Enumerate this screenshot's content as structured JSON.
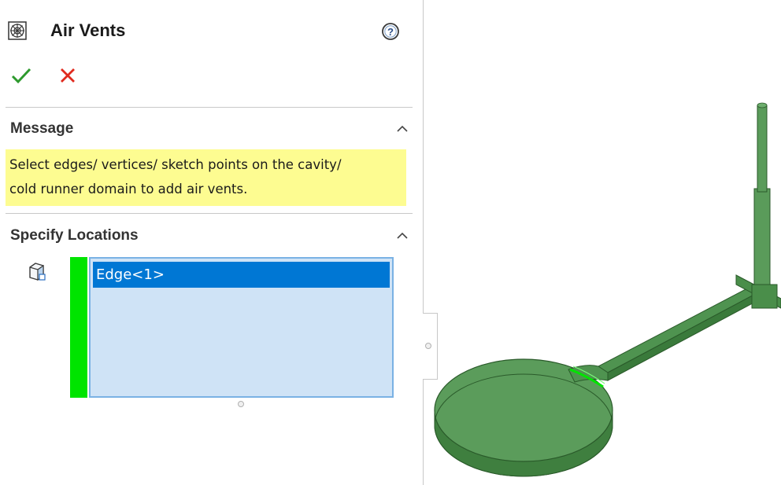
{
  "panel": {
    "title": "Air Vents",
    "icon": "air-vent-feature-icon",
    "help_icon": "help-icon",
    "ok_icon": "checkmark-icon",
    "cancel_icon": "close-icon",
    "ok_color": "#2e9a2e",
    "cancel_color": "#e02a1e"
  },
  "message_section": {
    "title": "Message",
    "collapse_icon": "chevron-up-icon",
    "lines": [
      "Select edges/ vertices/ sketch points on the cavity/",
      "cold runner domain to add air vents."
    ],
    "background": "#fdfc91"
  },
  "locations_section": {
    "title": "Specify Locations",
    "collapse_icon": "chevron-up-icon",
    "selection_icon": "edge-selection-icon",
    "status_color": "#00e400",
    "items": [
      {
        "label": "Edge<1>",
        "selected": true
      }
    ],
    "selected_color": "#0077d4",
    "list_background": "#cfe3f6"
  },
  "graphics": {
    "model_color": "#4e9a4e",
    "highlight_color": "#00e400"
  }
}
